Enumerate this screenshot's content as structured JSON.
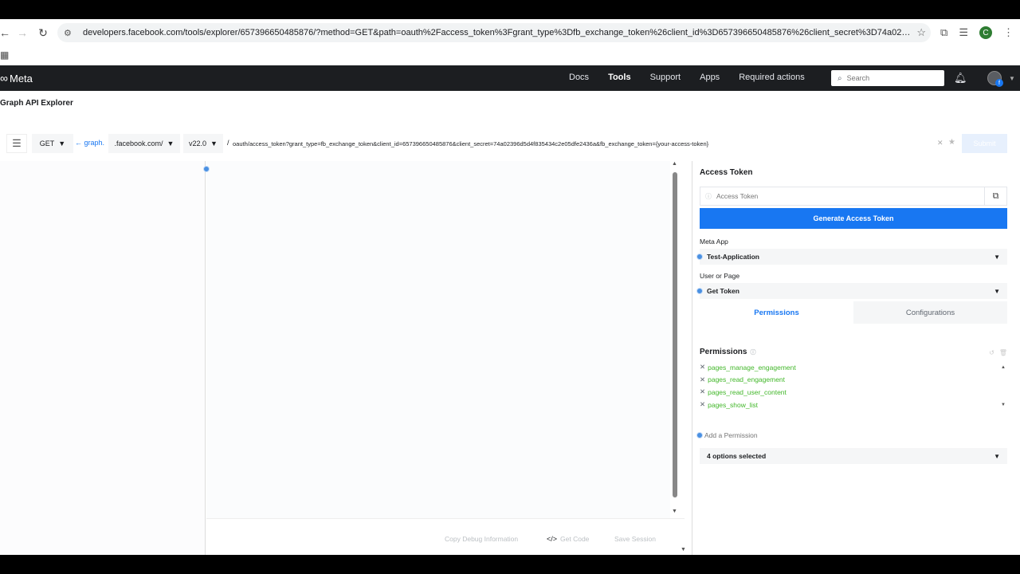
{
  "browser": {
    "url_host": "developers.facebook.com",
    "url_path": "/tools/explorer/657396650485876/?method=GET&path=oauth%2Faccess_token%3Fgrant_type%3Dfb_exchange_token%26client_id%3D657396650485876%26client_secret%3D74a02396d5d4f835434c2...",
    "profile_initial": "C"
  },
  "meta_nav": {
    "logo": "Meta",
    "links": [
      "Docs",
      "Tools",
      "Support",
      "Apps",
      "Required actions"
    ],
    "active_link": "Tools",
    "search_placeholder": "Search"
  },
  "page": {
    "title": "Graph API Explorer"
  },
  "query": {
    "method": "GET",
    "host_prefix": "← graph.",
    "domain": ".facebook.com/",
    "version": "v22.0",
    "slash": "/",
    "path": "oauth/access_token?grant_type=fb_exchange_token&client_id=657396650485876&client_secret=74a02396d5d4f835434c2e05dfe2436a&fb_exchange_token={your-access-token}",
    "submit_label": "Submit"
  },
  "bottom_actions": {
    "copy_debug": "Copy Debug Information",
    "get_code": "Get Code",
    "save_session": "Save Session"
  },
  "side": {
    "access_token_title": "Access Token",
    "access_token_placeholder": "Access Token",
    "generate_label": "Generate Access Token",
    "meta_app_label": "Meta App",
    "meta_app_value": "Test-Application",
    "user_page_label": "User or Page",
    "user_page_value": "Get Token",
    "tabs": [
      "Permissions",
      "Configurations"
    ],
    "permissions_title": "Permissions",
    "permissions": [
      "pages_manage_engagement",
      "pages_read_engagement",
      "pages_read_user_content",
      "pages_show_list"
    ],
    "add_permission_placeholder": "Add a Permission",
    "options_selected": "4 options selected"
  },
  "colors": {
    "accent": "#1877f2",
    "permission_green": "#42b72a",
    "nav_bg": "#1c1e21"
  }
}
